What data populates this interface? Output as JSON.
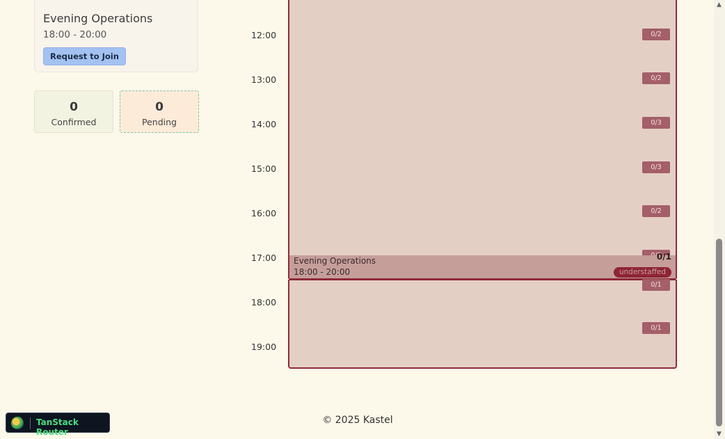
{
  "shift_card": {
    "title": "Evening Operations",
    "time": "18:00 - 20:00",
    "join_label": "Request to Join"
  },
  "stats": {
    "confirmed": {
      "value": "0",
      "label": "Confirmed"
    },
    "pending": {
      "value": "0",
      "label": "Pending"
    }
  },
  "calendar": {
    "hours": [
      "12:00",
      "13:00",
      "14:00",
      "15:00",
      "16:00",
      "17:00",
      "18:00",
      "19:00"
    ],
    "slot_badges": [
      "0/2",
      "0/2",
      "0/3",
      "0/3",
      "0/2",
      "0/2",
      "0/1",
      "0/1"
    ],
    "evening_block": {
      "title": "Evening Operations",
      "time": "18:00 - 20:00",
      "count": "0/1",
      "status": "understaffed"
    }
  },
  "footer": {
    "text": "© 2025 Kastel"
  },
  "devtools": {
    "label": "TanStack Router"
  },
  "colors": {
    "background": "#fcf8ea",
    "join_button": "#a3c2f2",
    "shift_block": "#e4cfc5",
    "shift_border": "#8e2a3a",
    "badge": "#a45f69",
    "understaffed": "#8e2434",
    "tanstack_text": "#4ade80"
  }
}
